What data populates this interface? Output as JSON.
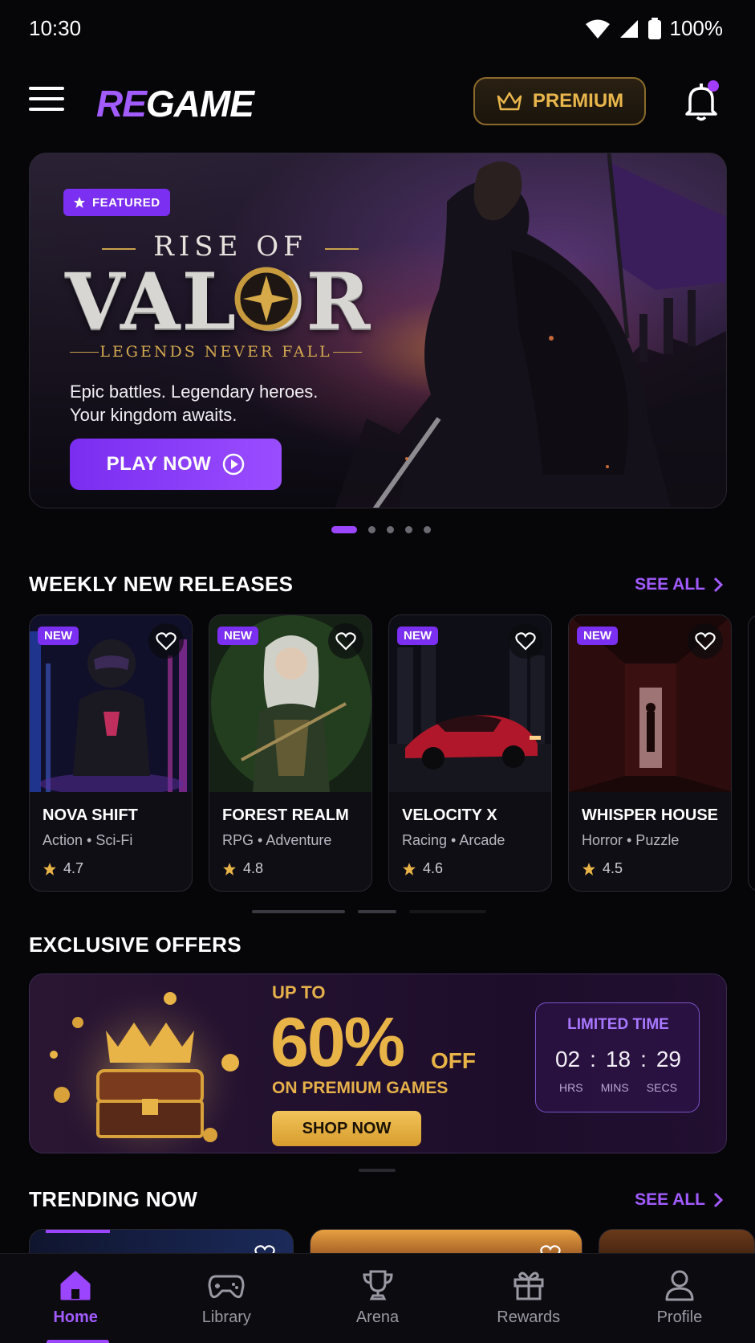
{
  "status_bar": {
    "time": "10:30",
    "battery": "100%"
  },
  "header": {
    "logo_re": "RE",
    "logo_game": "GAME",
    "premium_label": "PREMIUM"
  },
  "hero": {
    "badge": "FEATURED",
    "title_top": "RISE OF",
    "title": "VALOR",
    "subtitle": "LEGENDS NEVER FALL",
    "desc_line1": "Epic battles. Legendary heroes.",
    "desc_line2": "Your kingdom awaits.",
    "cta": "PLAY NOW",
    "pages": 5,
    "active_page": 1
  },
  "weekly": {
    "title": "WEEKLY NEW RELEASES",
    "see_all": "SEE ALL",
    "games": [
      {
        "badge": "NEW",
        "title": "NOVA SHIFT",
        "genre": "Action • Sci-Fi",
        "rating": "4.7"
      },
      {
        "badge": "NEW",
        "title": "FOREST REALM",
        "genre": "RPG • Adventure",
        "rating": "4.8"
      },
      {
        "badge": "NEW",
        "title": "VELOCITY X",
        "genre": "Racing • Arcade",
        "rating": "4.6"
      },
      {
        "badge": "NEW",
        "title": "WHISPER HOUSE",
        "genre": "Horror • Puzzle",
        "rating": "4.5"
      }
    ]
  },
  "offers": {
    "title": "EXCLUSIVE OFFERS",
    "up_to": "UP TO",
    "percent": "60%",
    "off": "OFF",
    "on": "ON PREMIUM GAMES",
    "cta": "SHOP NOW",
    "timer_label": "LIMITED TIME",
    "hrs": "02",
    "mins": "18",
    "secs": "29",
    "hrs_label": "HRS",
    "mins_label": "MINS",
    "secs_label": "SECS",
    "separator": ":"
  },
  "trending": {
    "title": "TRENDING NOW",
    "see_all": "SEE ALL"
  },
  "nav": [
    {
      "label": "Home",
      "icon": "home-icon",
      "active": true
    },
    {
      "label": "Library",
      "icon": "gamepad-icon",
      "active": false
    },
    {
      "label": "Arena",
      "icon": "trophy-icon",
      "active": false
    },
    {
      "label": "Rewards",
      "icon": "gift-icon",
      "active": false
    },
    {
      "label": "Profile",
      "icon": "user-icon",
      "active": false
    }
  ],
  "colors": {
    "accent": "#9b45ff",
    "gold": "#e8b347",
    "background": "#060609"
  }
}
